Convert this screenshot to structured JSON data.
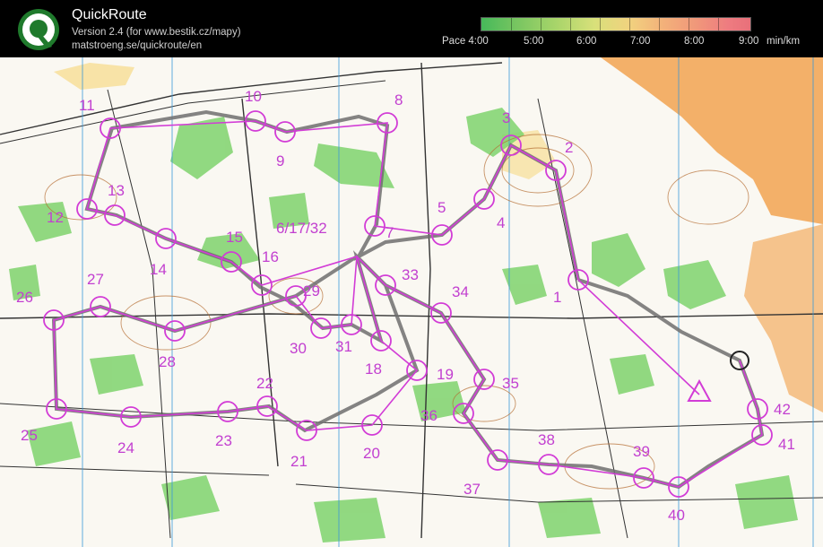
{
  "app": {
    "title": "QuickRoute",
    "version": "Version 2.4  (for www.bestik.cz/mapy)",
    "url": "matstroeng.se/quickroute/en"
  },
  "pace_scale": {
    "label": "Pace 4:00",
    "ticks": [
      "5:00",
      "6:00",
      "7:00",
      "8:00",
      "9:00"
    ],
    "unit": "min/km"
  },
  "colors": {
    "course": "#d23cd6",
    "route": "#6f6f6f",
    "forest": "#7ed36d",
    "openland": "#f2a85a"
  },
  "controls": [
    {
      "n": "1",
      "label": "1"
    },
    {
      "n": "2",
      "label": "2"
    },
    {
      "n": "3",
      "label": "3"
    },
    {
      "n": "4",
      "label": "4"
    },
    {
      "n": "5",
      "label": "5"
    },
    {
      "n": "6",
      "label": "6/17/32"
    },
    {
      "n": "7",
      "label": "7"
    },
    {
      "n": "8",
      "label": "8"
    },
    {
      "n": "9",
      "label": "9"
    },
    {
      "n": "10",
      "label": "10"
    },
    {
      "n": "11",
      "label": "11"
    },
    {
      "n": "12",
      "label": "12"
    },
    {
      "n": "13",
      "label": "13"
    },
    {
      "n": "14",
      "label": "14"
    },
    {
      "n": "15",
      "label": "15"
    },
    {
      "n": "16",
      "label": "16"
    },
    {
      "n": "18",
      "label": "18"
    },
    {
      "n": "19",
      "label": "19"
    },
    {
      "n": "20",
      "label": "20"
    },
    {
      "n": "21",
      "label": "21"
    },
    {
      "n": "22",
      "label": "22"
    },
    {
      "n": "23",
      "label": "23"
    },
    {
      "n": "24",
      "label": "24"
    },
    {
      "n": "25",
      "label": "25"
    },
    {
      "n": "26",
      "label": "26"
    },
    {
      "n": "27",
      "label": "27"
    },
    {
      "n": "28",
      "label": "28"
    },
    {
      "n": "29",
      "label": "29"
    },
    {
      "n": "30",
      "label": "30"
    },
    {
      "n": "31",
      "label": "31"
    },
    {
      "n": "33",
      "label": "33"
    },
    {
      "n": "34",
      "label": "34"
    },
    {
      "n": "35",
      "label": "35"
    },
    {
      "n": "36",
      "label": "36"
    },
    {
      "n": "37",
      "label": "37"
    },
    {
      "n": "38",
      "label": "38"
    },
    {
      "n": "39",
      "label": "39"
    },
    {
      "n": "40",
      "label": "40"
    },
    {
      "n": "41",
      "label": "41"
    },
    {
      "n": "42",
      "label": "42"
    }
  ]
}
